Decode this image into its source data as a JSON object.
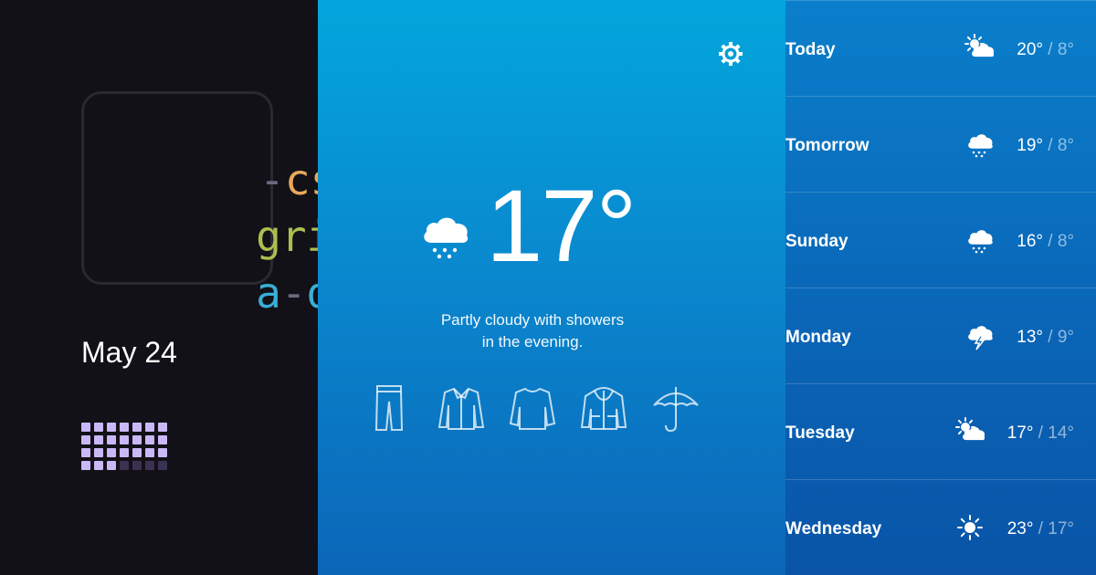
{
  "logo": {
    "lines": [
      {
        "text": "-css-",
        "dash_color": "#6a6a7e",
        "word_color": "#e8a85a"
      },
      {
        "text": "grid-",
        "dash_color": "#6a6a7e",
        "word_color": "#a9c04f"
      },
      {
        "text": "a-day",
        "dash_color": "#6a6a7e",
        "word_color": "#3aaed6"
      }
    ]
  },
  "date": "May 24",
  "calendar": {
    "filled_color": "#c9b8f5",
    "empty_color": "#3a3250",
    "filled_count": 24,
    "total": 28
  },
  "current": {
    "temp": "17°",
    "icon": "cloud-rain-icon",
    "description_line1": "Partly cloudy with showers",
    "description_line2": "in the evening."
  },
  "clothing": [
    "pants-icon",
    "shirt-icon",
    "sweater-icon",
    "jacket-icon",
    "umbrella-icon"
  ],
  "forecast": [
    {
      "day": "Today",
      "icon": "sun-cloud-icon",
      "high": "20°",
      "low": "8°"
    },
    {
      "day": "Tomorrow",
      "icon": "cloud-rain-icon",
      "high": "19°",
      "low": "8°"
    },
    {
      "day": "Sunday",
      "icon": "cloud-rain-icon",
      "high": "16°",
      "low": "8°"
    },
    {
      "day": "Monday",
      "icon": "cloud-lightning-icon",
      "high": "13°",
      "low": "9°"
    },
    {
      "day": "Tuesday",
      "icon": "sun-cloud-icon",
      "high": "17°",
      "low": "14°"
    },
    {
      "day": "Wednesday",
      "icon": "sun-icon",
      "high": "23°",
      "low": "17°"
    }
  ],
  "colors": {
    "main_top": "#03a6dc",
    "main_bottom": "#0b66b8",
    "sidebar_bg": "#121117"
  }
}
